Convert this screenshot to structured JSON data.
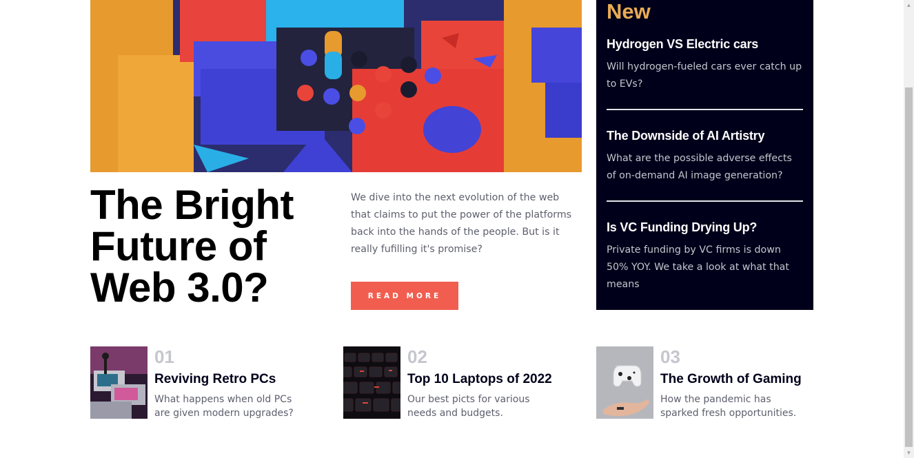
{
  "hero": {
    "title": "The Bright Future of Web 3.0?",
    "description": "We dive into the next evolution of the web that claims to put the power of the platforms back into the hands of the people. But is it really fufilling it's promise?",
    "read_more_label": "Read More"
  },
  "new_panel": {
    "heading": "New",
    "items": [
      {
        "title": "Hydrogen VS Electric cars",
        "description": "Will hydrogen-fueled cars ever catch up to EVs?"
      },
      {
        "title": "The Downside of AI Artistry",
        "description": "What are the possible adverse effects of on-demand AI image generation?"
      },
      {
        "title": "Is VC Funding Drying Up?",
        "description": "Private funding by VC firms is down 50% YOY. We take a look at what that means"
      }
    ]
  },
  "cards": [
    {
      "number": "01",
      "title": "Reviving Retro PCs",
      "description": "What happens when old PCs are given modern upgrades?"
    },
    {
      "number": "02",
      "title": "Top 10 Laptops of 2022",
      "description": "Our best picts for various needs and budgets."
    },
    {
      "number": "03",
      "title": "The Growth of Gaming",
      "description": "How the pandemic has sparked fresh opportunities."
    }
  ],
  "colors": {
    "accent": "#f15e50",
    "panel_bg": "#00001a",
    "new_heading": "#e9ab53"
  }
}
